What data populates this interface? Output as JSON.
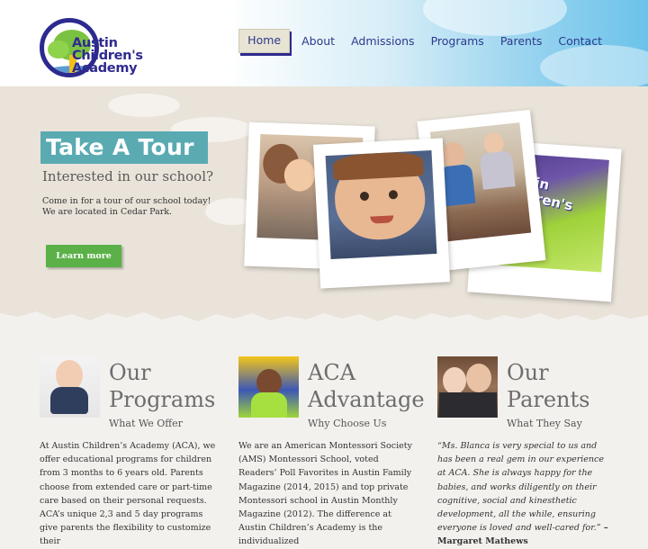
{
  "logo": {
    "line1": "Austin",
    "line2": "Children's",
    "line3": "Academy"
  },
  "nav": [
    {
      "label": "Home"
    },
    {
      "label": "About"
    },
    {
      "label": "Admissions"
    },
    {
      "label": "Programs"
    },
    {
      "label": "Parents"
    },
    {
      "label": "Contact"
    }
  ],
  "hero": {
    "title": "Take A Tour",
    "subtitle": "Interested in our school?",
    "text_line1": "Come in for a tour of our school today!",
    "text_line2": "We are located in Cedar Park.",
    "button": "Learn more",
    "sign_text": "Austin Children's"
  },
  "columns": [
    {
      "title_line1": "Our",
      "title_line2": "Programs",
      "tagline": "What We Offer",
      "body": "At Austin Children’s Academy (ACA), we offer educational programs for children from 3 months to 6 years old. Parents choose from extended care or part-time care based on their personal requests. ACA’s unique 2,3 and 5 day programs give parents the flexibility to customize their"
    },
    {
      "title_line1": "ACA",
      "title_line2": "Advantage",
      "tagline": "Why Choose Us",
      "body": "We are an American Montessori Society (AMS) Montessori School, voted Readers’ Poll Favorites in Austin Family Magazine (2014, 2015) and top private Montessori school in Austin Monthly Magazine (2012). The difference at Austin Children’s Academy is the individualized"
    },
    {
      "title_line1": "Our",
      "title_line2": "Parents",
      "tagline": "What They Say",
      "quote": "“Ms. Blanca is very special to us and has been a real gem in our experience at ACA. She is always happy for the babies, and works diligently on their cognitive, social and kinesthetic development, all the while, ensuring everyone is loved and well-cared for.”",
      "author": " – Margaret Mathews"
    }
  ],
  "colors": {
    "navy": "#2d2a8f",
    "teal": "#5aaab2",
    "green": "#5bb148",
    "sky": "#6bc3ea"
  }
}
